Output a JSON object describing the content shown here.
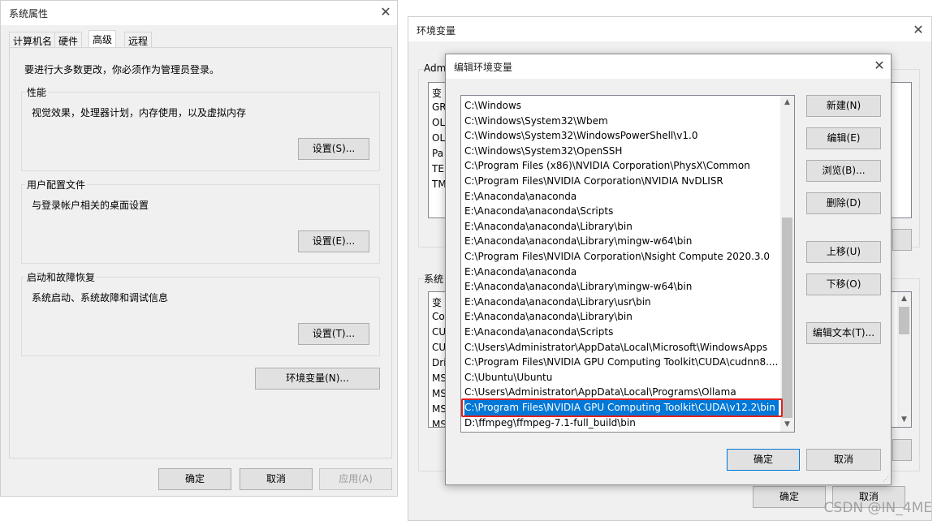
{
  "sys_props": {
    "title": "系统属性",
    "tabs": [
      "计算机名",
      "硬件",
      "高级",
      "远程"
    ],
    "admin_note": "要进行大多数更改，你必须作为管理员登录。",
    "performance": {
      "label": "性能",
      "desc": "视觉效果，处理器计划，内存使用，以及虚拟内存",
      "button": "设置(S)..."
    },
    "profiles": {
      "label": "用户配置文件",
      "desc": "与登录帐户相关的桌面设置",
      "button": "设置(E)..."
    },
    "startup": {
      "label": "启动和故障恢复",
      "desc": "系统启动、系统故障和调试信息",
      "button": "设置(T)..."
    },
    "env_button": "环境变量(N)...",
    "ok": "确定",
    "cancel": "取消",
    "apply": "应用(A)"
  },
  "env_vars": {
    "title": "环境变量",
    "user_group_label": "Adm",
    "user_rows": [
      "变",
      "GR",
      "OL",
      "OL",
      "Pa",
      "TE",
      "TM"
    ],
    "sys_group_label": "系统",
    "sys_rows": [
      "变",
      "Co",
      "CU",
      "CU",
      "Dri",
      "MS",
      "MS",
      "MS",
      "MS"
    ],
    "ok": "确定",
    "cancel": "取消"
  },
  "edit_env": {
    "title": "编辑环境变量",
    "paths": [
      "C:\\Windows",
      "C:\\Windows\\System32\\Wbem",
      "C:\\Windows\\System32\\WindowsPowerShell\\v1.0",
      "C:\\Windows\\System32\\OpenSSH",
      "C:\\Program Files (x86)\\NVIDIA Corporation\\PhysX\\Common",
      "C:\\Program Files\\NVIDIA Corporation\\NVIDIA NvDLISR",
      "E:\\Anaconda\\anaconda",
      "E:\\Anaconda\\anaconda\\Scripts",
      "E:\\Anaconda\\anaconda\\Library\\bin",
      "E:\\Anaconda\\anaconda\\Library\\mingw-w64\\bin",
      "C:\\Program Files\\NVIDIA Corporation\\Nsight Compute 2020.3.0",
      "E:\\Anaconda\\anaconda",
      "E:\\Anaconda\\anaconda\\Library\\mingw-w64\\bin",
      "E:\\Anaconda\\anaconda\\Library\\usr\\bin",
      "E:\\Anaconda\\anaconda\\Library\\bin",
      "E:\\Anaconda\\anaconda\\Scripts",
      "C:\\Users\\Administrator\\AppData\\Local\\Microsoft\\WindowsApps",
      "C:\\Program Files\\NVIDIA GPU Computing Toolkit\\CUDA\\cudnn8....",
      "C:\\Ubuntu\\Ubuntu",
      "C:\\Users\\Administrator\\AppData\\Local\\Programs\\Ollama",
      "C:\\Program Files\\NVIDIA GPU Computing Toolkit\\CUDA\\v12.2\\bin",
      "D:\\ffmpeg\\ffmpeg-7.1-full_build\\bin"
    ],
    "selected_index": 20,
    "buttons": {
      "new": "新建(N)",
      "edit": "编辑(E)",
      "browse": "浏览(B)...",
      "delete": "删除(D)",
      "up": "上移(U)",
      "down": "下移(O)",
      "edit_text": "编辑文本(T)...",
      "ok": "确定",
      "cancel": "取消"
    }
  },
  "watermark": "CSDN @IN_4ME",
  "colors": {
    "highlight": "#e02020",
    "selection": "#0078d7"
  }
}
